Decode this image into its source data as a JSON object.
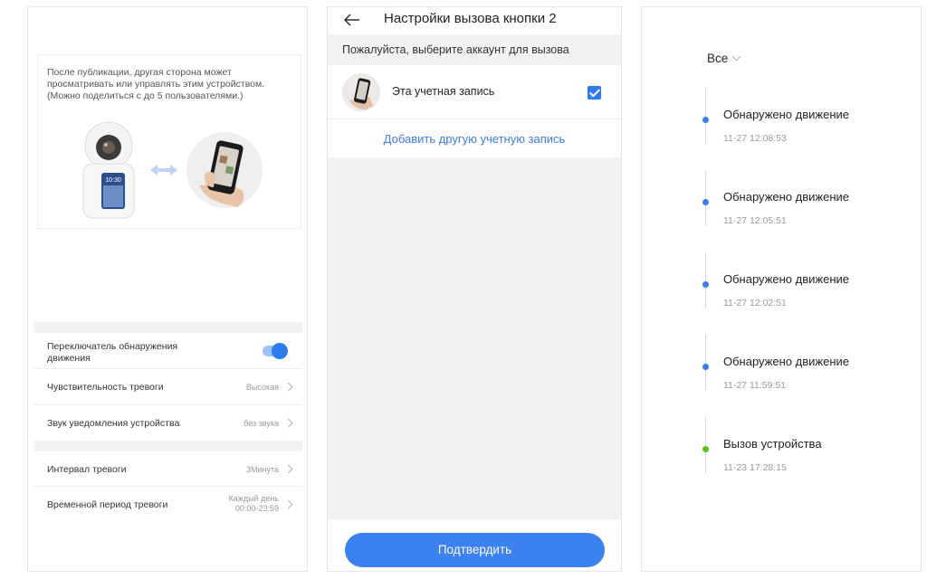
{
  "motion_settings": {
    "share_text": "После публикации, другая сторона может просматривать или управлять этим устройством. (Можно поделиться с до 5 пользователями.)",
    "illustration_time": "10:30",
    "rows": [
      {
        "label": "Переключатель обнаружения движения",
        "type": "toggle",
        "on": true
      },
      {
        "label": "Чувствительность тревоги",
        "value": "Высокая"
      },
      {
        "label": "Звук уведомления устройства",
        "value": "без звука"
      },
      {
        "label": "Интервал тревоги",
        "value": "3Минута"
      },
      {
        "label": "Временной период тревоги",
        "value": "Каждый день",
        "value2": "00:00-23:59"
      }
    ],
    "toggle_color": "#2f7bf0"
  },
  "call_settings": {
    "title": "Настройки вызова кнопки 2",
    "subtitle": "Пожалуйста, выберите аккаунт для вызова",
    "account_label": "Эта учетная запись",
    "account_checked": true,
    "add_account": "Добавить другую учетную запись",
    "confirm_label": "Подтвердить",
    "accent": "#3b82f0"
  },
  "event_log": {
    "filter_label": "Все",
    "events": [
      {
        "title": "Обнаружено движение",
        "time": "11-27 12:08:53",
        "dot_color": "#3a7ce6"
      },
      {
        "title": "Обнаружено движение",
        "time": "11-27 12:05:51",
        "dot_color": "#3a7ce6"
      },
      {
        "title": "Обнаружено движение",
        "time": "11-27 12:02:51",
        "dot_color": "#3a7ce6"
      },
      {
        "title": "Обнаружено движение",
        "time": "11-27 11:59:51",
        "dot_color": "#3a7ce6"
      },
      {
        "title": "Вызов устройства",
        "time": "11-23 17:28:15",
        "dot_color": "#52c41a"
      }
    ]
  }
}
